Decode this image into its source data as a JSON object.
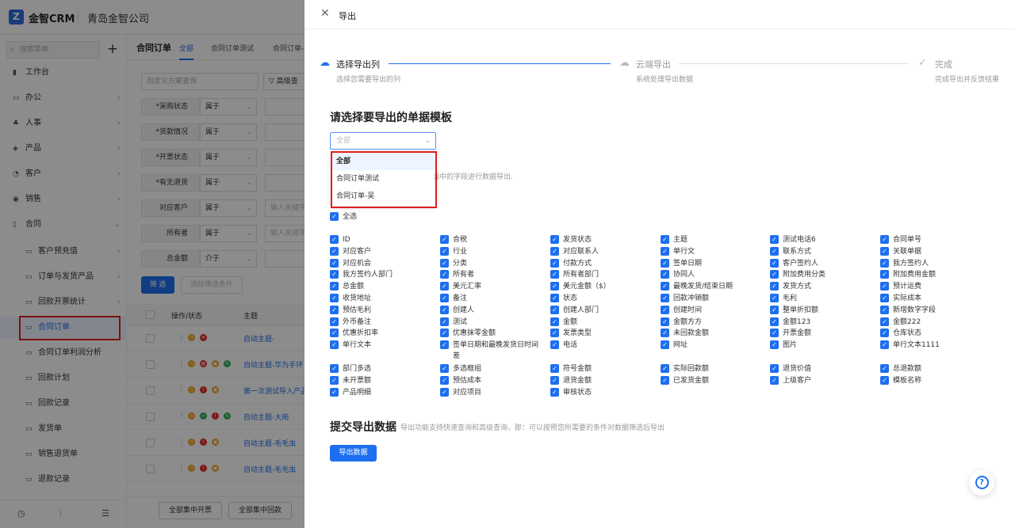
{
  "app": {
    "logo_glyph": "Z",
    "name": "金智CRM",
    "company": "青岛金智公司"
  },
  "sidebar": {
    "search_placeholder": "搜索菜单",
    "add_label": "+",
    "items": [
      {
        "icon": "workbench-icon",
        "glyph": "▮",
        "label": "工作台"
      },
      {
        "icon": "office-icon",
        "glyph": "▭",
        "label": "办公",
        "arrow": "›"
      },
      {
        "icon": "hr-icon",
        "glyph": "♣",
        "label": "人事",
        "arrow": "›"
      },
      {
        "icon": "product-icon",
        "glyph": "◈",
        "label": "产品",
        "arrow": "›"
      },
      {
        "icon": "customer-icon",
        "glyph": "◔",
        "label": "客户",
        "arrow": "›"
      },
      {
        "icon": "sales-icon",
        "glyph": "◉",
        "label": "销售",
        "arrow": "›"
      },
      {
        "icon": "contract-icon",
        "glyph": "▯",
        "label": "合同",
        "arrow": "⌄"
      }
    ],
    "sub_items": [
      {
        "label": "客户预充值",
        "arrow": "›"
      },
      {
        "label": "订单与发货产品",
        "arrow": "›"
      },
      {
        "label": "回款开票统计",
        "arrow": "›"
      },
      {
        "label": "合同订单",
        "active": true
      },
      {
        "label": "合同订单利润分析"
      },
      {
        "label": "回款计划"
      },
      {
        "label": "回款记录"
      },
      {
        "label": "发货单"
      },
      {
        "label": "销售退货单"
      },
      {
        "label": "退款记录"
      }
    ],
    "footer": [
      "◷",
      "⫶",
      "☰"
    ]
  },
  "main": {
    "title": "合同订单",
    "tabs": [
      "全部",
      "合同订单测试",
      "合同订单-"
    ],
    "filter_placeholder": "自定义方案查询",
    "advanced_label": "▽ 高级查",
    "conditions": [
      {
        "label": "*采购状态",
        "op": "属于",
        "val": ""
      },
      {
        "label": "*货款情况",
        "op": "属于",
        "val": ""
      },
      {
        "label": "*开票状态",
        "op": "属于",
        "val": ""
      },
      {
        "label": "*有无退货",
        "op": "属于",
        "val": ""
      },
      {
        "label": "对应客户",
        "op": "属于",
        "val": "输入关键字"
      },
      {
        "label": "所有者",
        "op": "属于",
        "val": "输入关键字"
      },
      {
        "label": "总金额",
        "op": "介于",
        "val": ""
      }
    ],
    "filter_btn": "筛 选",
    "clear_btn": "清除筛选条件",
    "table_headers": [
      "操作/状态",
      "主题"
    ],
    "rows": [
      {
        "subject": "自动主题-"
      },
      {
        "subject": "自动主题-华为手环"
      },
      {
        "subject": "第一次测试导入产品"
      },
      {
        "subject": "自动主题-大雨"
      },
      {
        "subject": "自动主题-毛毛虫"
      },
      {
        "subject": "自动主题-毛毛虫"
      }
    ],
    "bottom_buttons": [
      "全部集中开票",
      "全部集中回款"
    ]
  },
  "drawer": {
    "title": "导出",
    "steps": [
      {
        "title": "选择导出列",
        "desc": "选择您需要导出的列"
      },
      {
        "title": "云端导出",
        "desc": "系统处理导出数据"
      },
      {
        "title": "完成",
        "desc": "完成导出并反馈结果"
      }
    ],
    "template_section_title": "请选择要导出的单据模板",
    "template_placeholder": "全部",
    "template_options": [
      "全部",
      "合同订单测试",
      "合同订单-吴"
    ],
    "hint": "您选中的字段进行数据导出.",
    "select_all": "全选",
    "fields": [
      [
        "ID",
        "合税",
        "发货状态",
        "主题",
        "测试电话6",
        "合同单号"
      ],
      [
        "对应客户",
        "行业",
        "对应联系人",
        "单行文",
        "联系方式",
        "关联单据"
      ],
      [
        "对应机会",
        "分类",
        "付款方式",
        "签单日期",
        "客户签约人",
        "我方签约人"
      ],
      [
        "我方签约人部门",
        "所有者",
        "所有者部门",
        "协同人",
        "附加费用分类",
        "附加费用金额"
      ],
      [
        "总金额",
        "美元汇率",
        "美元金额（$）",
        "最晚发货/结束日期",
        "发货方式",
        "预计运费"
      ],
      [
        "收货地址",
        "备注",
        "状态",
        "回款冲销额",
        "毛利",
        "实际成本"
      ],
      [
        "预估毛利",
        "创建人",
        "创建人部门",
        "创建时间",
        "整单折扣额",
        "新增数字字段"
      ],
      [
        "外币备注",
        "测试",
        "金额",
        "金额方方",
        "金额123",
        "金额222"
      ],
      [
        "优惠折扣率",
        "优惠抹零金额",
        "发票类型",
        "未回款金额",
        "开票金额",
        "仓库状态"
      ],
      [
        "单行文本",
        "签单日期和最晚发货日时间差",
        "电话",
        "网址",
        "图片",
        "单行文本1111"
      ],
      [
        "部门多选",
        "多选框组",
        "符号金额",
        "实际回款额",
        "退货价值",
        "总退款额"
      ],
      [
        "未开票额",
        "预估成本",
        "退货金额",
        "已发货金额",
        "上级客户",
        "模板名称"
      ],
      [
        "产品明细",
        "对应项目",
        "审核状态"
      ]
    ],
    "submit_title": "提交导出数据",
    "submit_desc": "导出功能支持快速查询和高级查询，即：可以按照您所需要的条件对数据筛选后导出",
    "export_btn": "导出数据",
    "help": "?"
  },
  "colors": {
    "accent": "#1e6ff0",
    "highlight_border": "#e02020"
  }
}
